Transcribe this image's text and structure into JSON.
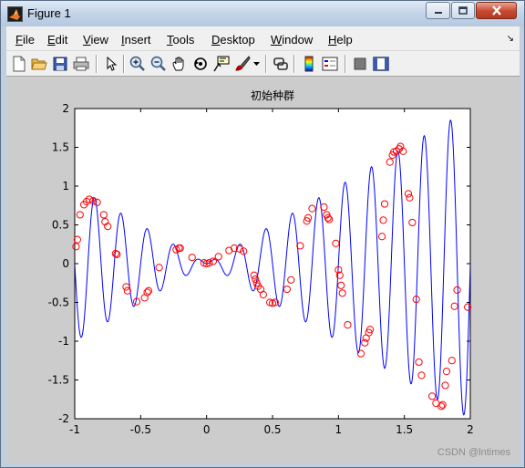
{
  "window": {
    "title": "Figure 1",
    "controls": {
      "minimize": "minimize",
      "maximize": "maximize",
      "close": "close"
    }
  },
  "menubar": {
    "items": [
      {
        "key": "F",
        "rest": "ile"
      },
      {
        "key": "E",
        "rest": "dit"
      },
      {
        "key": "V",
        "rest": "iew"
      },
      {
        "key": "I",
        "rest": "nsert"
      },
      {
        "key": "T",
        "rest": "ools"
      },
      {
        "key": "D",
        "rest": "esktop"
      },
      {
        "key": "W",
        "rest": "indow"
      },
      {
        "key": "H",
        "rest": "elp"
      }
    ],
    "arrow": "↘"
  },
  "toolbar": {
    "icons": [
      "new-figure-icon",
      "open-file-icon",
      "save-icon",
      "print-icon",
      "pointer-icon",
      "zoom-in-icon",
      "zoom-out-icon",
      "pan-icon",
      "rotate-icon",
      "data-cursor-icon",
      "brush-icon",
      "link-icon",
      "colorbar-icon",
      "legend-icon",
      "hide-plot-tools-icon",
      "show-plot-tools-icon"
    ]
  },
  "watermark": "CSDN @lntimes",
  "chart_data": {
    "type": "line",
    "title": "初始种群",
    "xlabel": "",
    "ylabel": "",
    "xlim": [
      -1,
      2
    ],
    "ylim": [
      -2,
      2
    ],
    "xticks": [
      "-1",
      "-0.5",
      "0",
      "0.5",
      "1",
      "1.5",
      "2"
    ],
    "yticks": [
      "2",
      "1.5",
      "1",
      "0.5",
      "0",
      "-0.5",
      "-1",
      "-1.5",
      "-2"
    ],
    "grid": false,
    "series": [
      {
        "name": "",
        "style": "line",
        "color": "#0000ff",
        "function": "x*sin(10*pi*x)",
        "x_range": [
          -1,
          2
        ]
      },
      {
        "name": "",
        "style": "markers",
        "marker": "circle",
        "color": "#ff0000",
        "x": [
          -0.99,
          -0.98,
          -0.96,
          -0.93,
          -0.91,
          -0.89,
          -0.86,
          -0.83,
          -0.78,
          -0.77,
          -0.75,
          -0.69,
          -0.68,
          -0.61,
          -0.6,
          -0.53,
          -0.47,
          -0.45,
          -0.44,
          -0.36,
          -0.23,
          -0.21,
          -0.2,
          -0.11,
          -0.02,
          0.0,
          0.02,
          0.05,
          0.09,
          0.17,
          0.21,
          0.25,
          0.28,
          0.36,
          0.37,
          0.38,
          0.39,
          0.41,
          0.43,
          0.48,
          0.5,
          0.52,
          0.61,
          0.64,
          0.71,
          0.76,
          0.77,
          0.8,
          0.89,
          0.91,
          0.92,
          0.93,
          0.98,
          1.0,
          1.01,
          1.02,
          1.03,
          1.07,
          1.17,
          1.2,
          1.21,
          1.23,
          1.24,
          1.33,
          1.34,
          1.35,
          1.39,
          1.41,
          1.42,
          1.44,
          1.46,
          1.47,
          1.49,
          1.53,
          1.54,
          1.56,
          1.59,
          1.61,
          1.63,
          1.71,
          1.74,
          1.78,
          1.79,
          1.81,
          1.82,
          1.86,
          1.88,
          1.9,
          1.98
        ],
        "y": [
          0.22,
          0.31,
          0.63,
          0.76,
          0.8,
          0.83,
          0.81,
          0.79,
          0.63,
          0.54,
          0.48,
          0.13,
          0.12,
          -0.3,
          -0.35,
          -0.49,
          -0.44,
          -0.37,
          -0.35,
          -0.05,
          0.18,
          0.2,
          0.2,
          0.08,
          0.01,
          0.0,
          0.01,
          0.03,
          0.09,
          0.17,
          0.2,
          0.19,
          0.16,
          -0.15,
          -0.2,
          -0.25,
          -0.29,
          -0.33,
          -0.4,
          -0.5,
          -0.51,
          -0.5,
          -0.33,
          -0.21,
          0.23,
          0.55,
          0.59,
          0.71,
          0.73,
          0.63,
          0.59,
          0.57,
          0.26,
          -0.08,
          -0.15,
          -0.28,
          -0.38,
          -0.79,
          -1.16,
          -1.02,
          -0.96,
          -0.89,
          -0.85,
          0.35,
          0.56,
          0.77,
          1.31,
          1.4,
          1.44,
          1.45,
          1.48,
          1.51,
          1.45,
          0.9,
          0.85,
          0.53,
          -0.46,
          -1.27,
          -1.44,
          -1.71,
          -1.8,
          -1.84,
          -1.82,
          -1.57,
          -1.39,
          -1.25,
          -0.55,
          -0.34,
          -0.56
        ]
      }
    ]
  }
}
